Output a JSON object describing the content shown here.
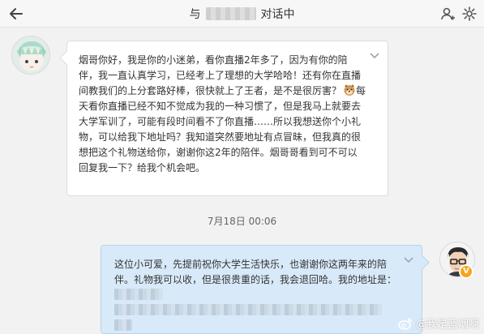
{
  "header": {
    "title_prefix": "与",
    "title_suffix": "对话中",
    "back_icon": "arrow-left-icon",
    "icons": [
      "user-add-icon",
      "gear-icon"
    ]
  },
  "messages": [
    {
      "side": "left",
      "avatar_icon": "cartoon-face-avatar",
      "text_before_emoji": "烟哥你好，我是你的小迷弟，看你直播2年多了，因为有你的陪伴，我一直认真学习，已经考上了理想的大学哈哈！还有你在直播间教我们的上分套路好棒，很快就上了王者，是不是很厉害？",
      "emoji": "dog-emoji",
      "text_after_emoji": "每天看你直播已经不知不觉成为我的一种习惯了，但是我马上就要去大学军训了，可能有段时间看不了你直播……所以我想送你个小礼物，可以给我下地址吗？我知道突然要地址有点冒昧，但我真的很想把这个礼物送给你，谢谢你这2年的陪伴。烟哥哥看到可不可以回复我一下？给我个机会吧。"
    },
    {
      "side": "right",
      "avatar_icon": "glasses-man-avatar",
      "badge": "V",
      "text": "这位小可爱，先提前祝你大学生活快乐，也谢谢你这两年来的陪伴。礼物我可以收，但是很贵重的话，我会退回哈。我的地址是："
    }
  ],
  "timestamp": "7月18日 00:06",
  "watermark": "@我是蓝烟啊",
  "colors": {
    "left_bubble": "#ffffff",
    "right_bubble": "#d8eaf9",
    "badge": "#f7a51c"
  }
}
